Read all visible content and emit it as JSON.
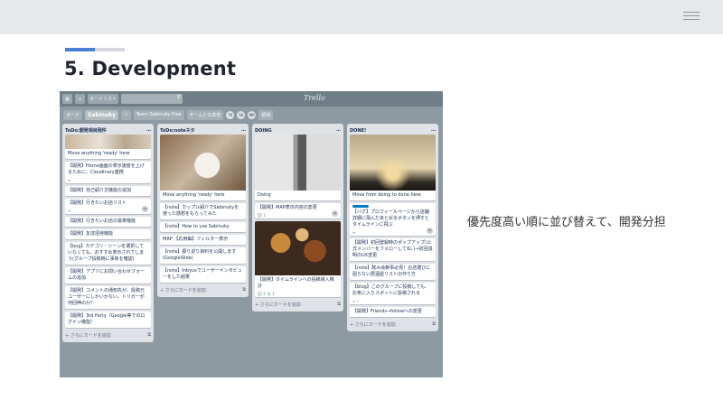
{
  "slide": {
    "title": "5. Development",
    "note": "優先度高い順に並び替えて、開発分担",
    "progress": 0.5
  },
  "trello": {
    "header": {
      "boards_label": "ボードリスト",
      "logo": "Trello"
    },
    "board": {
      "name": "Sabinuky",
      "team": "Team Sabinuky",
      "team_badge": "Free",
      "visibility": "チームとの共有",
      "members": [
        "TK",
        "SK",
        "MR"
      ],
      "invite_label": "招待"
    },
    "add_card_label": "+ さらにカードを追加",
    "lists": [
      {
        "title": "ToDo:開発項目残件",
        "cards": [
          {
            "text": "Move anything 'ready' here",
            "badges": ""
          },
          {
            "text": "【開発】Home画面の表示速度を上げるために、Cloudinary連携",
            "badges": "≡"
          },
          {
            "text": "【開発】自己紹介文機能の追加",
            "badges": ""
          },
          {
            "text": "【開発】行きたいお店リスト",
            "badges": "≡"
          },
          {
            "text": "【開発】行きたいお店の最寄機能",
            "badges": ""
          },
          {
            "text": "【開発】友達招待機能",
            "badges": ""
          },
          {
            "text": "【bug】カテゴリ・シーンを選択していなくても、おすすめ表示されてしまう(グループ投稿時に事象を確認)",
            "badges": ""
          },
          {
            "text": "【開発】アプリにお問い合わせフォームの追加",
            "badges": ""
          },
          {
            "text": "【開発】コメントの通知先が、投稿元ユーザーにしかいかない。トリガーが何回伸のか？",
            "badges": ""
          },
          {
            "text": "【開発】3rd Party（Google等でのログイン機能）",
            "badges": ""
          }
        ]
      },
      {
        "title": "ToDo:noteネタ",
        "cards": [
          {
            "text": "Move anything 'ready' here",
            "badges": ""
          },
          {
            "text": "【note】カップル紹介でSabinukyを使った感想をもらってみた",
            "badges": ""
          },
          {
            "text": "【note】How to use Sabinuky",
            "badges": ""
          },
          {
            "text": "MAP 【応用編】フィルター表示",
            "badges": ""
          },
          {
            "text": "【note】振り返り資料を公開します(GoogleSlide)",
            "badges": ""
          },
          {
            "text": "【note】Inbyusでユーザーインタビューをした結果",
            "badges": ""
          }
        ]
      },
      {
        "title": "DOING",
        "cards": [
          {
            "text": "Doing",
            "badges": ""
          },
          {
            "text": "【開発】MAP表示内容の変更",
            "badges": "💬 1"
          },
          {
            "text": "【開発】タイムラインへの投稿導入推計",
            "badges": "💬 2  📎 1"
          }
        ]
      },
      {
        "title": "DONE!",
        "cards": [
          {
            "text": "Move from doing to done here",
            "badges": ""
          },
          {
            "text": "【バグ】プロフィールページから店舗詳細に飛んだあと戻るボタンを押すとタイムラインに飛ぶ",
            "badges": "≡"
          },
          {
            "text": "【開発】初回登録時のポップアップ(公式メンバーをフォローしてね。)→初回説明のUX変更",
            "badges": ""
          },
          {
            "text": "【note】飲み会幹事必見！お店選びに困らない居酒屋リストの作り方",
            "badges": ""
          },
          {
            "text": "【blog】このグループに投稿しても、お気に入りスポットに投稿される",
            "badges": "≡ ✓"
          },
          {
            "text": "【開発】Friends→followへの変更",
            "badges": ""
          }
        ]
      }
    ]
  },
  "colors": {
    "accent": "#4a7fd6",
    "board_bg": "#8d9aa2",
    "list_bg": "#dfe2e6"
  }
}
